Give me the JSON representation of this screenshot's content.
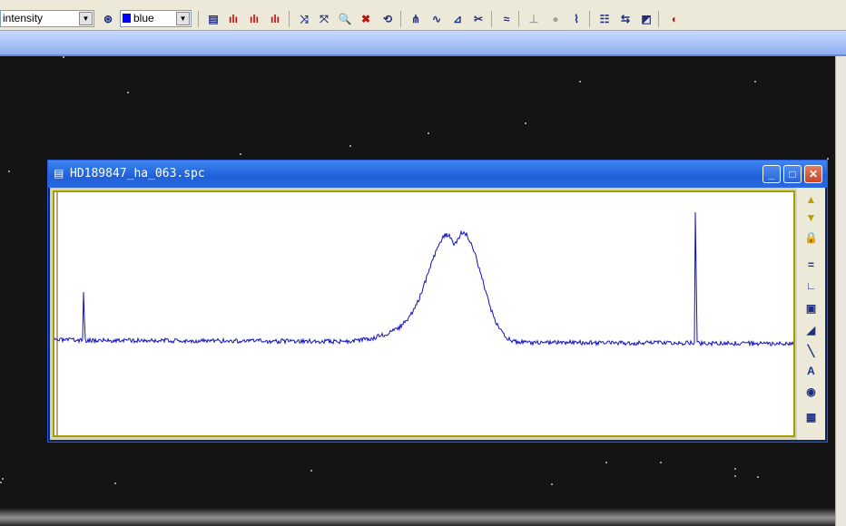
{
  "toolbar": {
    "mode_combo": {
      "value": "intensity"
    },
    "color_combo": {
      "value": "blue",
      "swatch_color": "#0000ff"
    },
    "buttons": [
      {
        "name": "spectrum-view-icon",
        "glyph": "▤"
      },
      {
        "name": "peaks-red-icon",
        "glyph": "ılı"
      },
      {
        "name": "peaks-red2-icon",
        "glyph": "ılı"
      },
      {
        "name": "peaks-red3-icon",
        "glyph": "ılı"
      },
      {
        "name": "fit-x-icon",
        "glyph": "⤨"
      },
      {
        "name": "fit-y-icon",
        "glyph": "⤧"
      },
      {
        "name": "zoom-icon",
        "glyph": "🔍"
      },
      {
        "name": "zoom-reset-icon",
        "glyph": "✖"
      },
      {
        "name": "refresh-view-icon",
        "glyph": "⟲"
      },
      {
        "name": "calib-icon",
        "glyph": "⋔"
      },
      {
        "name": "smooth-icon",
        "glyph": "∿"
      },
      {
        "name": "normalize-icon",
        "glyph": "⊿"
      },
      {
        "name": "crop-icon",
        "glyph": "✂"
      },
      {
        "name": "continuum-icon",
        "glyph": "≈"
      },
      {
        "name": "spikes-icon",
        "glyph": "⊥"
      },
      {
        "name": "drop-icon",
        "glyph": "●"
      },
      {
        "name": "measure-icon",
        "glyph": "⌇"
      },
      {
        "name": "table-icon",
        "glyph": "☷"
      },
      {
        "name": "compare-icon",
        "glyph": "⇆"
      },
      {
        "name": "graph-icon",
        "glyph": "◩"
      },
      {
        "name": "split-icon",
        "glyph": "◖"
      }
    ]
  },
  "window": {
    "title": "HD189847_ha_063.spc",
    "minimize_glyph": "_",
    "maximize_glyph": "□",
    "close_glyph": "✕"
  },
  "sidebar": {
    "buttons": [
      {
        "name": "arrow-up-icon",
        "glyph": "▲"
      },
      {
        "name": "arrow-down-icon",
        "glyph": "▼"
      },
      {
        "name": "lock-icon",
        "glyph": "🔒"
      },
      {
        "name": "equals-icon",
        "glyph": "="
      },
      {
        "name": "axes-icon",
        "glyph": "∟"
      },
      {
        "name": "frame-icon",
        "glyph": "▣"
      },
      {
        "name": "hatch-icon",
        "glyph": "◢"
      },
      {
        "name": "line-tool-icon",
        "glyph": "╲"
      },
      {
        "name": "text-tool-icon",
        "glyph": "A"
      },
      {
        "name": "camera-icon",
        "glyph": "◉"
      },
      {
        "name": "rainbow-icon",
        "glyph": "▦"
      }
    ]
  },
  "colors": {
    "spectrum_line": "#1010c0",
    "plot_frame": "#a0a000"
  }
}
